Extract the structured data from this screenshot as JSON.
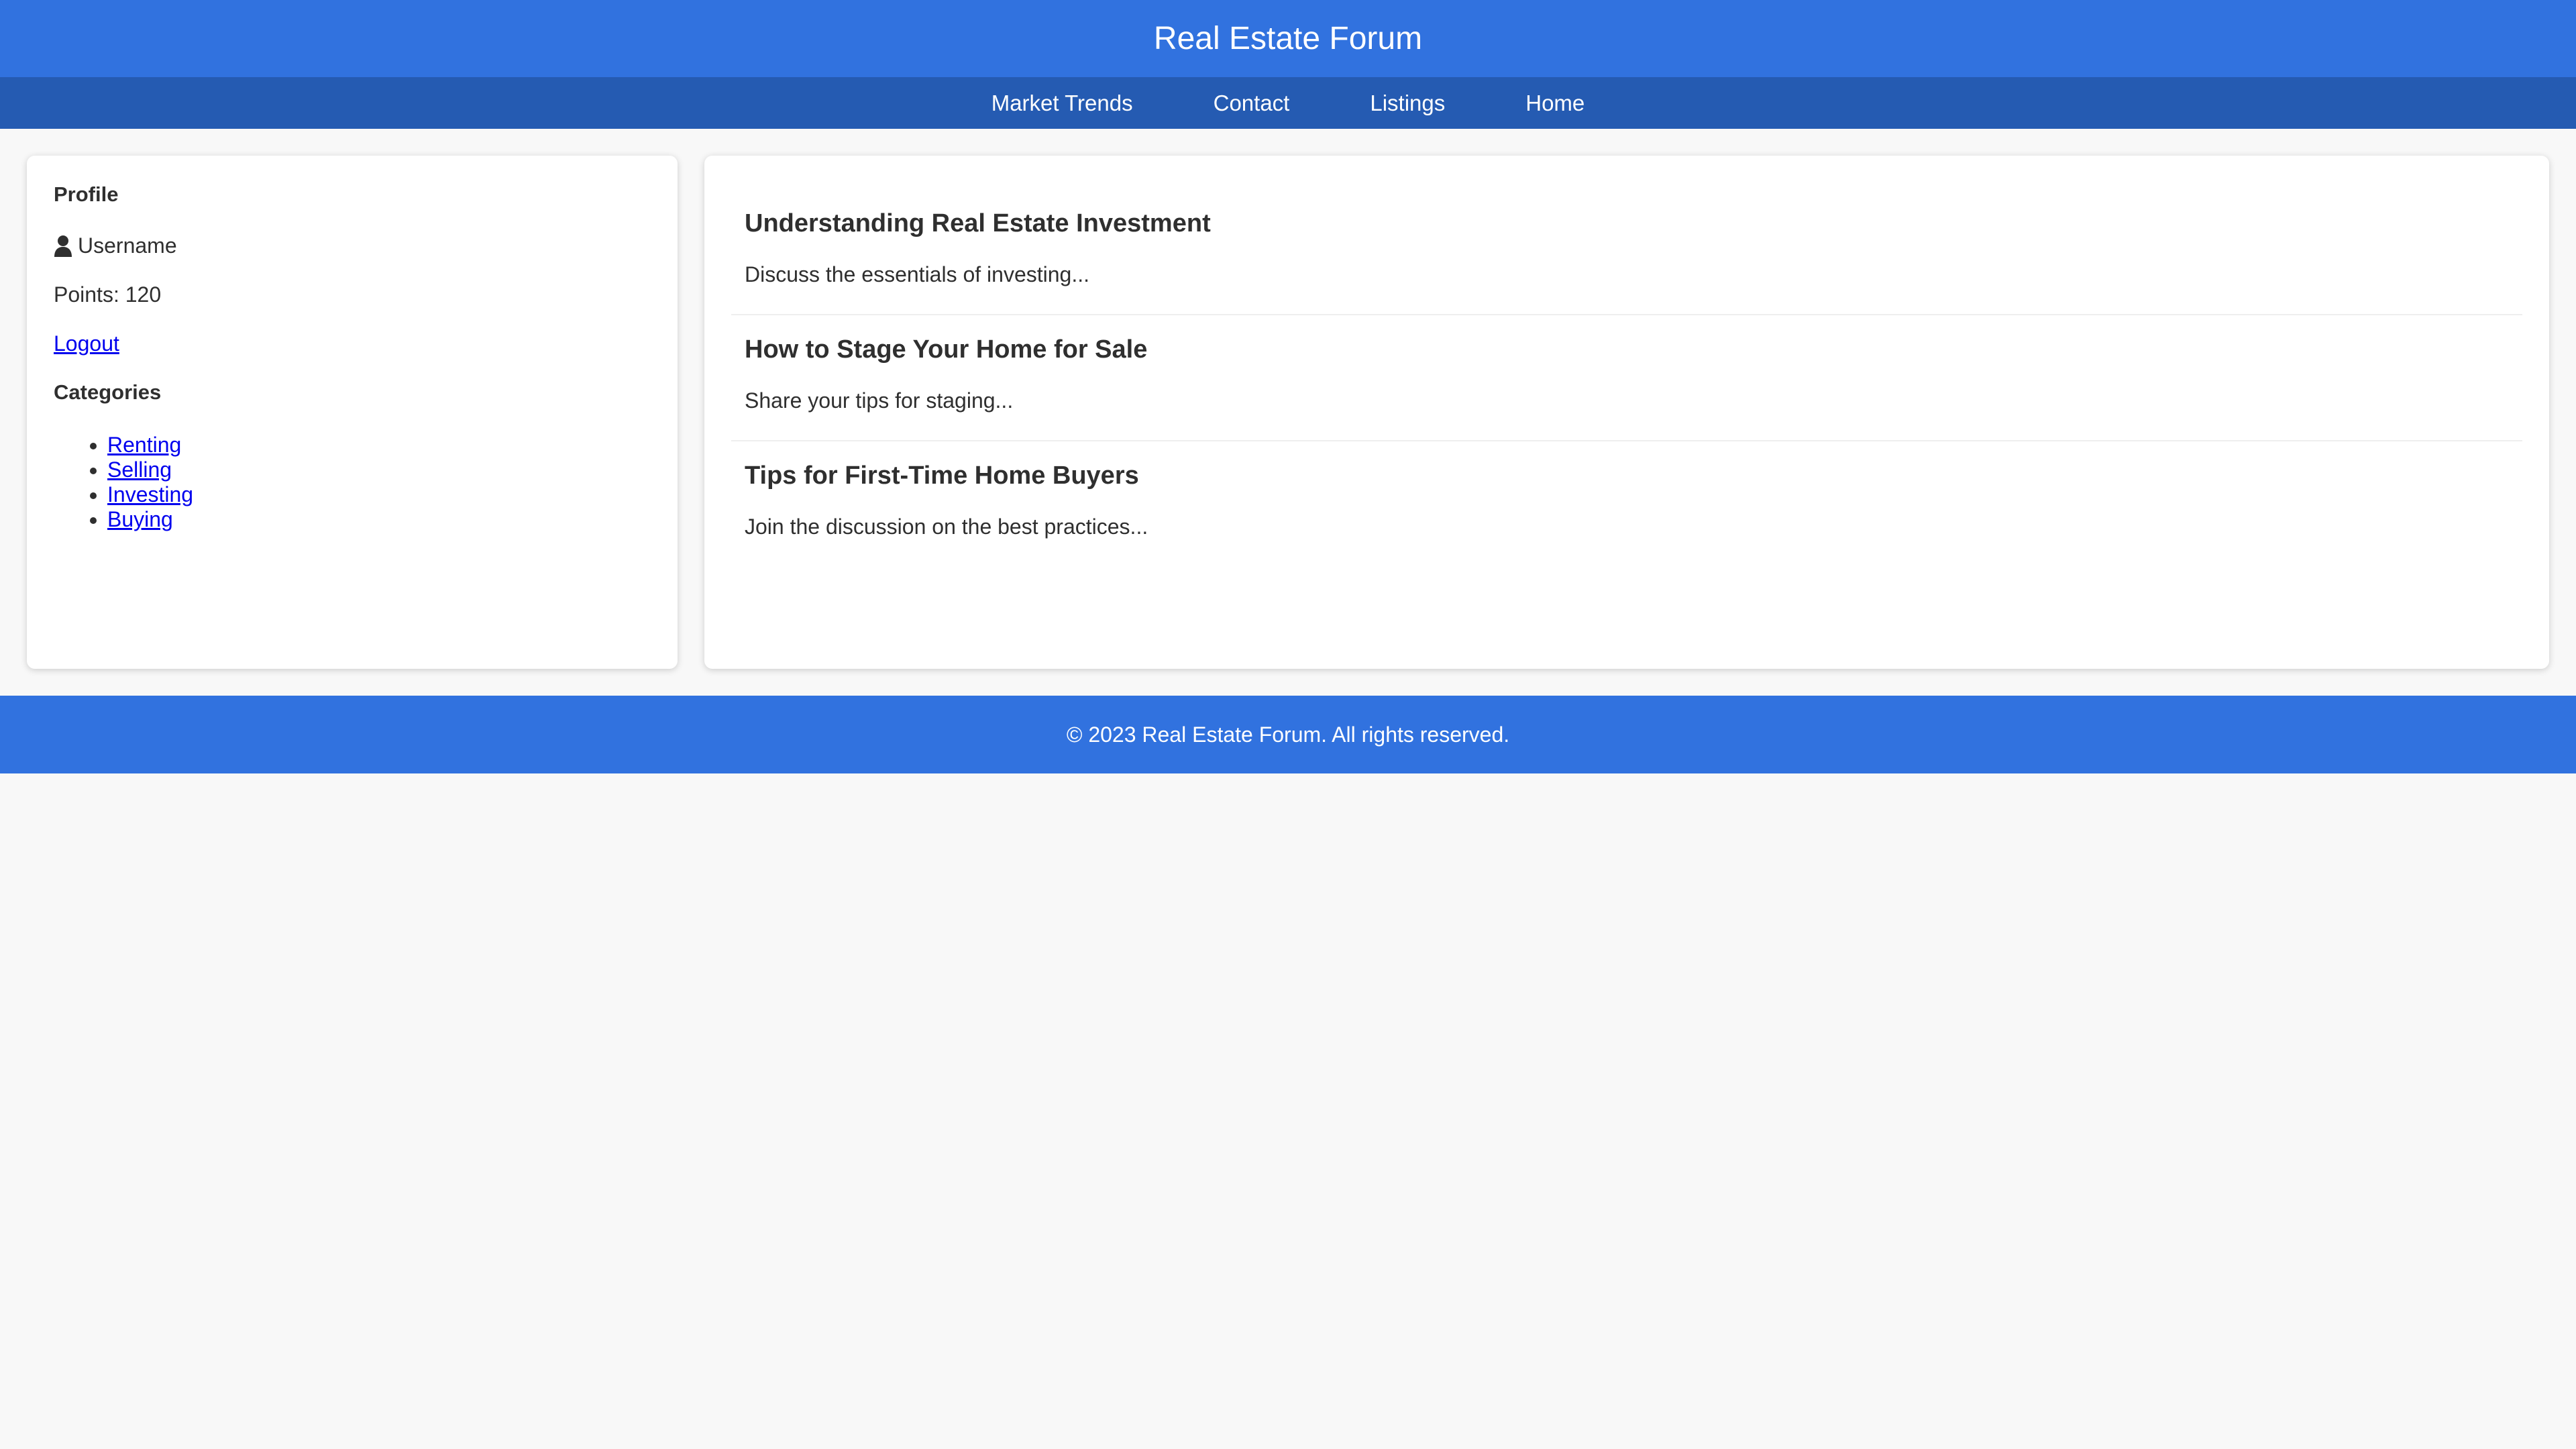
{
  "header": {
    "title": "Real Estate Forum"
  },
  "nav": {
    "items": [
      {
        "label": "Market Trends"
      },
      {
        "label": "Contact"
      },
      {
        "label": "Listings"
      },
      {
        "label": "Home"
      }
    ]
  },
  "sidebar": {
    "profile_heading": "Profile",
    "username": "Username",
    "user_icon": "user-icon",
    "points": "Points: 120",
    "logout_label": "Logout",
    "categories_heading": "Categories",
    "categories": [
      {
        "label": "Renting"
      },
      {
        "label": "Selling"
      },
      {
        "label": "Investing"
      },
      {
        "label": "Buying"
      }
    ]
  },
  "posts": [
    {
      "title": "Understanding Real Estate Investment",
      "description": "Discuss the essentials of investing..."
    },
    {
      "title": "How to Stage Your Home for Sale",
      "description": "Share your tips for staging..."
    },
    {
      "title": "Tips for First-Time Home Buyers",
      "description": "Join the discussion on the best practices..."
    }
  ],
  "footer": {
    "text": "© 2023 Real Estate Forum. All rights reserved."
  },
  "colors": {
    "header": "#3172df",
    "nav": "#255bb2",
    "link": "#0000ee",
    "background": "#f8f8f8"
  }
}
